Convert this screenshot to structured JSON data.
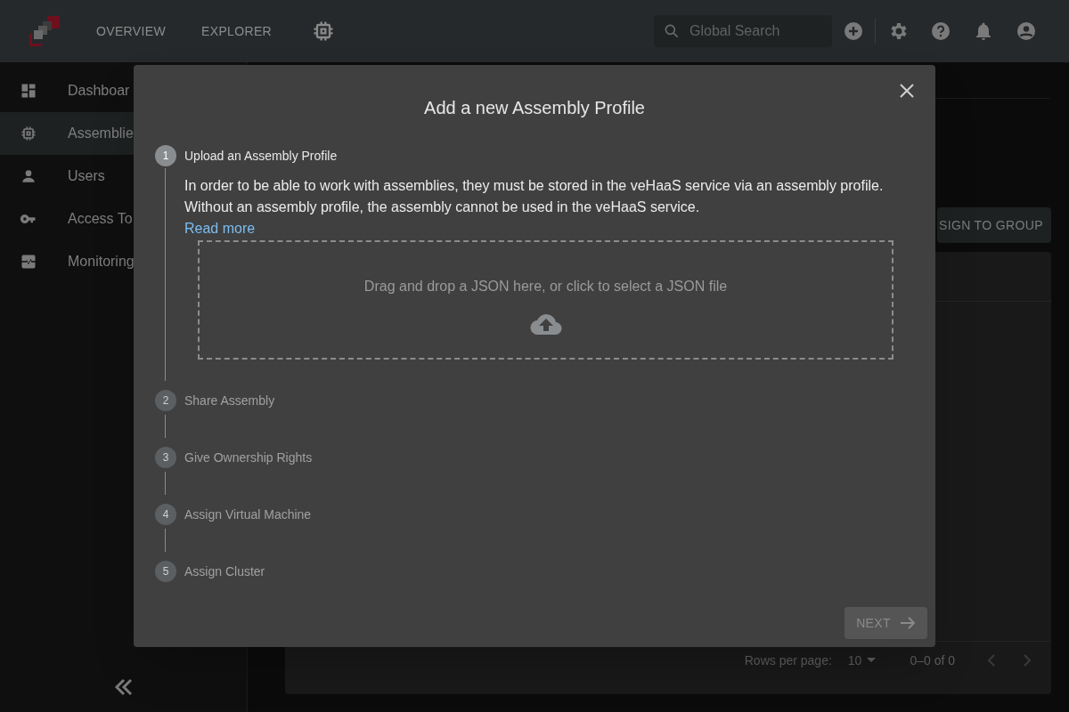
{
  "header": {
    "nav": [
      {
        "label": "OVERVIEW"
      },
      {
        "label": "EXPLORER"
      }
    ],
    "search": {
      "placeholder": "Global Search"
    }
  },
  "sidebar": {
    "items": [
      {
        "label": "Dashboar",
        "kind": "dashboard",
        "selected": false
      },
      {
        "label": "Assemblie",
        "kind": "chip",
        "selected": true
      },
      {
        "label": "Users",
        "kind": "person",
        "selected": false
      },
      {
        "label": "Access To",
        "kind": "key",
        "selected": false
      },
      {
        "label": "Monitoring",
        "kind": "monitor",
        "selected": false
      }
    ]
  },
  "toolbar": {
    "button": "SIGN TO GROUP"
  },
  "pagination": {
    "rows_label": "Rows per page:",
    "rows_value": "10",
    "range": "0–0 of 0"
  },
  "modal": {
    "title": "Add a new Assembly Profile",
    "steps": [
      {
        "number": "1",
        "label": "Upload an Assembly Profile",
        "active": true,
        "description": "In order to be able to work with assemblies, they must be stored in the veHaaS service via an assembly profile. Without an assembly profile, the assembly cannot be used in the veHaaS service.",
        "link": "Read more",
        "dropzone": "Drag and drop a JSON here, or click to select a JSON file"
      },
      {
        "number": "2",
        "label": "Share Assembly",
        "active": false
      },
      {
        "number": "3",
        "label": "Give Ownership Rights",
        "active": false
      },
      {
        "number": "4",
        "label": "Assign Virtual Machine",
        "active": false
      },
      {
        "number": "5",
        "label": "Assign Cluster",
        "active": false
      }
    ],
    "next_button": {
      "label": "NEXT",
      "disabled": true
    }
  }
}
